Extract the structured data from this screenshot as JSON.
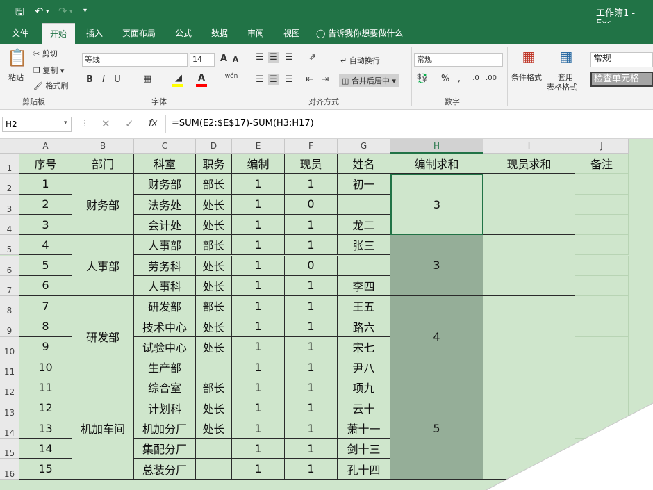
{
  "titlebar": {
    "save_icon": "save-icon",
    "undo_icon": "undo-icon",
    "redo_icon": "redo-icon",
    "customize_icon": "dropdown-icon",
    "doc_title": "工作簿1 - Exc"
  },
  "tabs": [
    "文件",
    "开始",
    "插入",
    "页面布局",
    "公式",
    "数据",
    "审阅",
    "视图"
  ],
  "tellme": "告诉我你想要做什么",
  "clipboard": {
    "paste": "粘贴",
    "cut": "剪切",
    "copy": "复制",
    "format_painter": "格式刷",
    "group": "剪贴板"
  },
  "font": {
    "name": "等线",
    "size": "14",
    "bold": "B",
    "italic": "I",
    "underline": "U",
    "group": "字体",
    "grow": "A",
    "shrink": "A",
    "phonetic": "wén"
  },
  "alignment": {
    "wrap": "自动换行",
    "merge": "合并后居中",
    "group": "对齐方式"
  },
  "number": {
    "format": "常规",
    "percent": "%",
    "comma": ",",
    "group": "数字"
  },
  "styles": {
    "conditional": "条件格式",
    "table": "套用",
    "table2": "表格格式",
    "normal": "常规",
    "check": "检查单元格"
  },
  "formula_bar": {
    "name_box": "H2",
    "fx": "fx",
    "formula": "=SUM(E2:$E$17)-SUM(H3:H17)"
  },
  "columns": [
    "A",
    "B",
    "C",
    "D",
    "E",
    "F",
    "G",
    "H",
    "I",
    "J"
  ],
  "rows": [
    "1",
    "2",
    "3",
    "4",
    "5",
    "6",
    "7",
    "8",
    "9",
    "10",
    "11",
    "12",
    "13",
    "14",
    "15",
    "16"
  ],
  "headers": [
    "序号",
    "部门",
    "科室",
    "职务",
    "编制",
    "现员",
    "姓名",
    "编制求和",
    "现员求和",
    "备注"
  ],
  "departments": [
    "财务部",
    "人事部",
    "研发部",
    "机加车间"
  ],
  "data": [
    [
      "1",
      "财务部",
      "部长",
      "1",
      "1",
      "初一"
    ],
    [
      "2",
      "法务处",
      "处长",
      "1",
      "0",
      ""
    ],
    [
      "3",
      "会计处",
      "处长",
      "1",
      "1",
      "龙二"
    ],
    [
      "4",
      "人事部",
      "部长",
      "1",
      "1",
      "张三"
    ],
    [
      "5",
      "劳务科",
      "处长",
      "1",
      "0",
      ""
    ],
    [
      "6",
      "人事科",
      "处长",
      "1",
      "1",
      "李四"
    ],
    [
      "7",
      "研发部",
      "部长",
      "1",
      "1",
      "王五"
    ],
    [
      "8",
      "技术中心",
      "处长",
      "1",
      "1",
      "路六"
    ],
    [
      "9",
      "试验中心",
      "处长",
      "1",
      "1",
      "宋七"
    ],
    [
      "10",
      "生产部",
      "",
      "1",
      "1",
      "尹八"
    ],
    [
      "11",
      "综合室",
      "部长",
      "1",
      "1",
      "项九"
    ],
    [
      "12",
      "计划科",
      "处长",
      "1",
      "1",
      "云十"
    ],
    [
      "13",
      "机加分厂",
      "处长",
      "1",
      "1",
      "萧十一"
    ],
    [
      "14",
      "集配分厂",
      "",
      "1",
      "1",
      "剑十三"
    ],
    [
      "15",
      "总装分厂",
      "",
      "1",
      "1",
      "孔十四"
    ]
  ],
  "sums": [
    "3",
    "3",
    "4",
    "5"
  ]
}
